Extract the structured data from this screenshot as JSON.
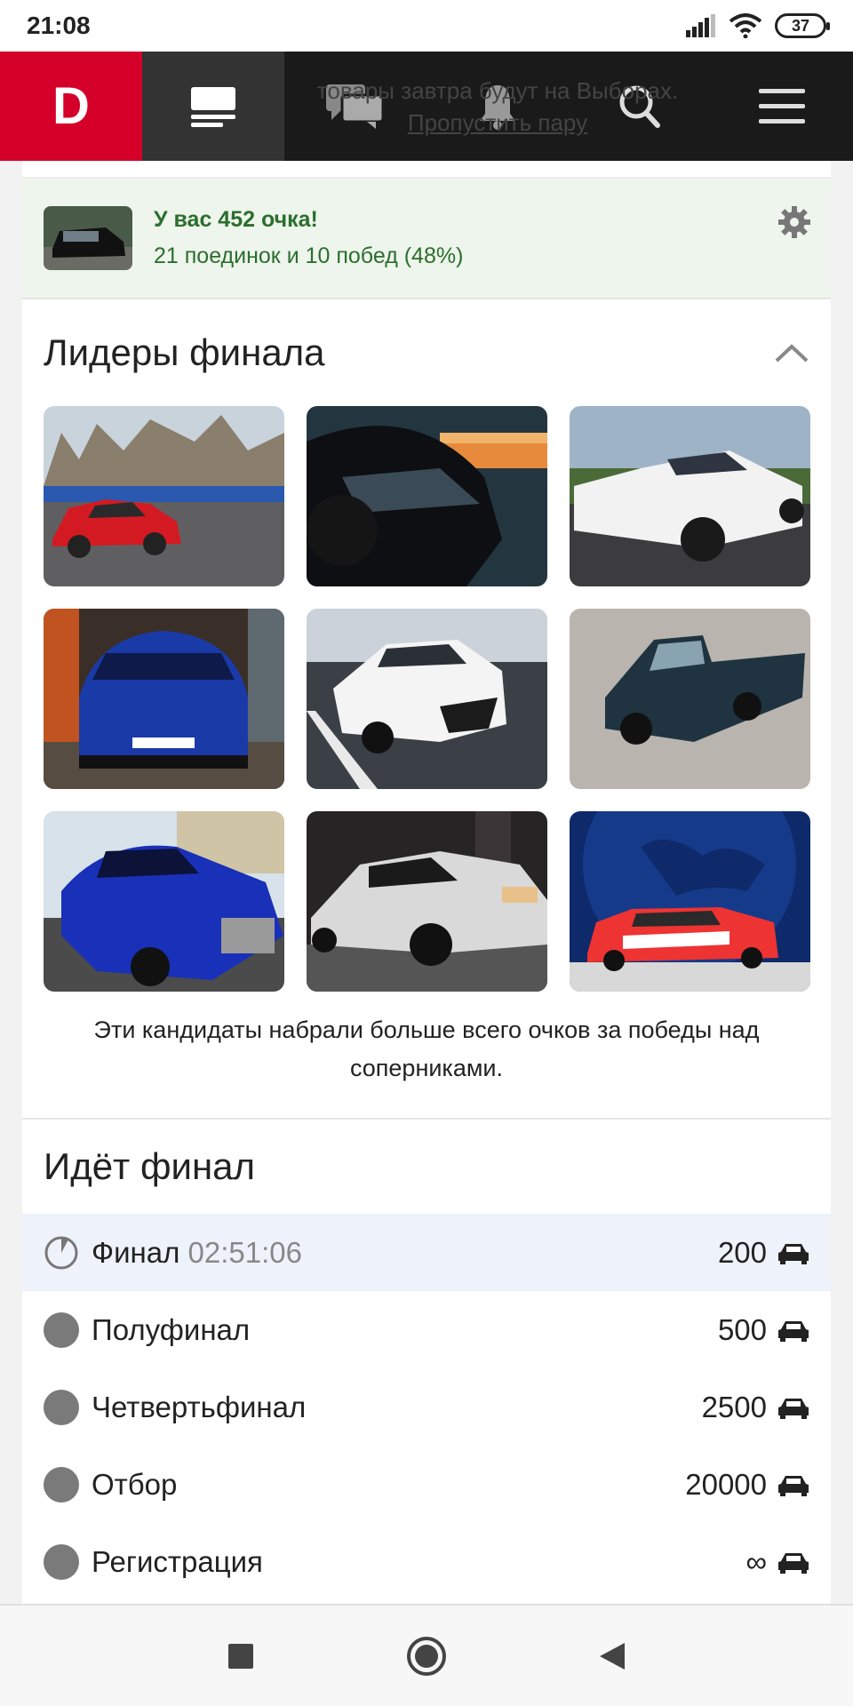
{
  "status_bar": {
    "time": "21:08",
    "battery": "37"
  },
  "ticker": {
    "text": "товары завтра будут на Выборах.",
    "skip": "Пропустить пару"
  },
  "nav": {
    "logo": "D"
  },
  "score": {
    "headline": "У вас 452 очка!",
    "stats": "21 поединок и 10 побед (48%)"
  },
  "leaders": {
    "title": "Лидеры финала",
    "caption": "Эти кандидаты набрали больше всего очков за победы над соперниками.",
    "tiles": [
      {
        "name": "red-sedan-mountains"
      },
      {
        "name": "black-car-sunset"
      },
      {
        "name": "white-sedan"
      },
      {
        "name": "blue-subaru"
      },
      {
        "name": "white-lexus"
      },
      {
        "name": "dark-pickup"
      },
      {
        "name": "blue-genesis"
      },
      {
        "name": "white-coupe-parking"
      },
      {
        "name": "red-white-sedan-map"
      }
    ]
  },
  "final": {
    "title": "Идёт финал",
    "rows": [
      {
        "label": "Финал",
        "timer": "02:51:06",
        "count": "200"
      },
      {
        "label": "Полуфинал",
        "timer": "",
        "count": "500"
      },
      {
        "label": "Четвертьфинал",
        "timer": "",
        "count": "2500"
      },
      {
        "label": "Отбор",
        "timer": "",
        "count": "20000"
      },
      {
        "label": "Регистрация",
        "timer": "",
        "count": "∞"
      }
    ]
  },
  "colors": {
    "brand": "#d4002a",
    "nav": "#1a1a1a",
    "score_bg": "#eef5ec",
    "score_text": "#2c6e2e"
  }
}
